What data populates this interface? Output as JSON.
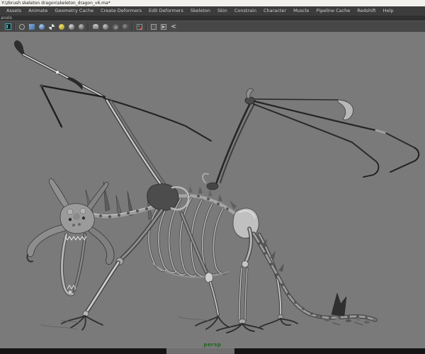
{
  "window": {
    "title": "Y:\\zbrush skeleton dragon\\skeleton_dragon_v6.ma*"
  },
  "menu_bar": {
    "items": [
      "Assets",
      "Animate",
      "Geometry Cache",
      "Create Deformers",
      "Edit Deformers",
      "Skeleton",
      "Skin",
      "Constrain",
      "Character",
      "Muscle",
      "Pipeline Cache",
      "Redshift",
      "Help"
    ]
  },
  "panels_menu": {
    "partial_label": "anels"
  },
  "viewport_toolbar": {
    "icons": [
      "camera-icon",
      "wireframe-icon",
      "shaded-cube-icon",
      "smooth-shaded-icon",
      "textured-icon",
      "all-lights-icon",
      "shadows-icon",
      "ao-icon",
      "lamp-icon",
      "sphere-icon-a",
      "sphere-icon-b",
      "sphere-icon-c",
      "isolate-select-icon",
      "cube-icon-a",
      "cube-icon-b",
      "share-icon"
    ]
  },
  "viewport": {
    "camera_label": "persp",
    "model": "skeleton dragon",
    "background_color": "#7a7a7a"
  },
  "colors": {
    "camera_label_green": "#1e651e",
    "title_bg": "#f2f1ee",
    "menu_bg": "#3c3c3c",
    "toolbar_bg": "#474747",
    "bottom_bar": "#141414"
  }
}
